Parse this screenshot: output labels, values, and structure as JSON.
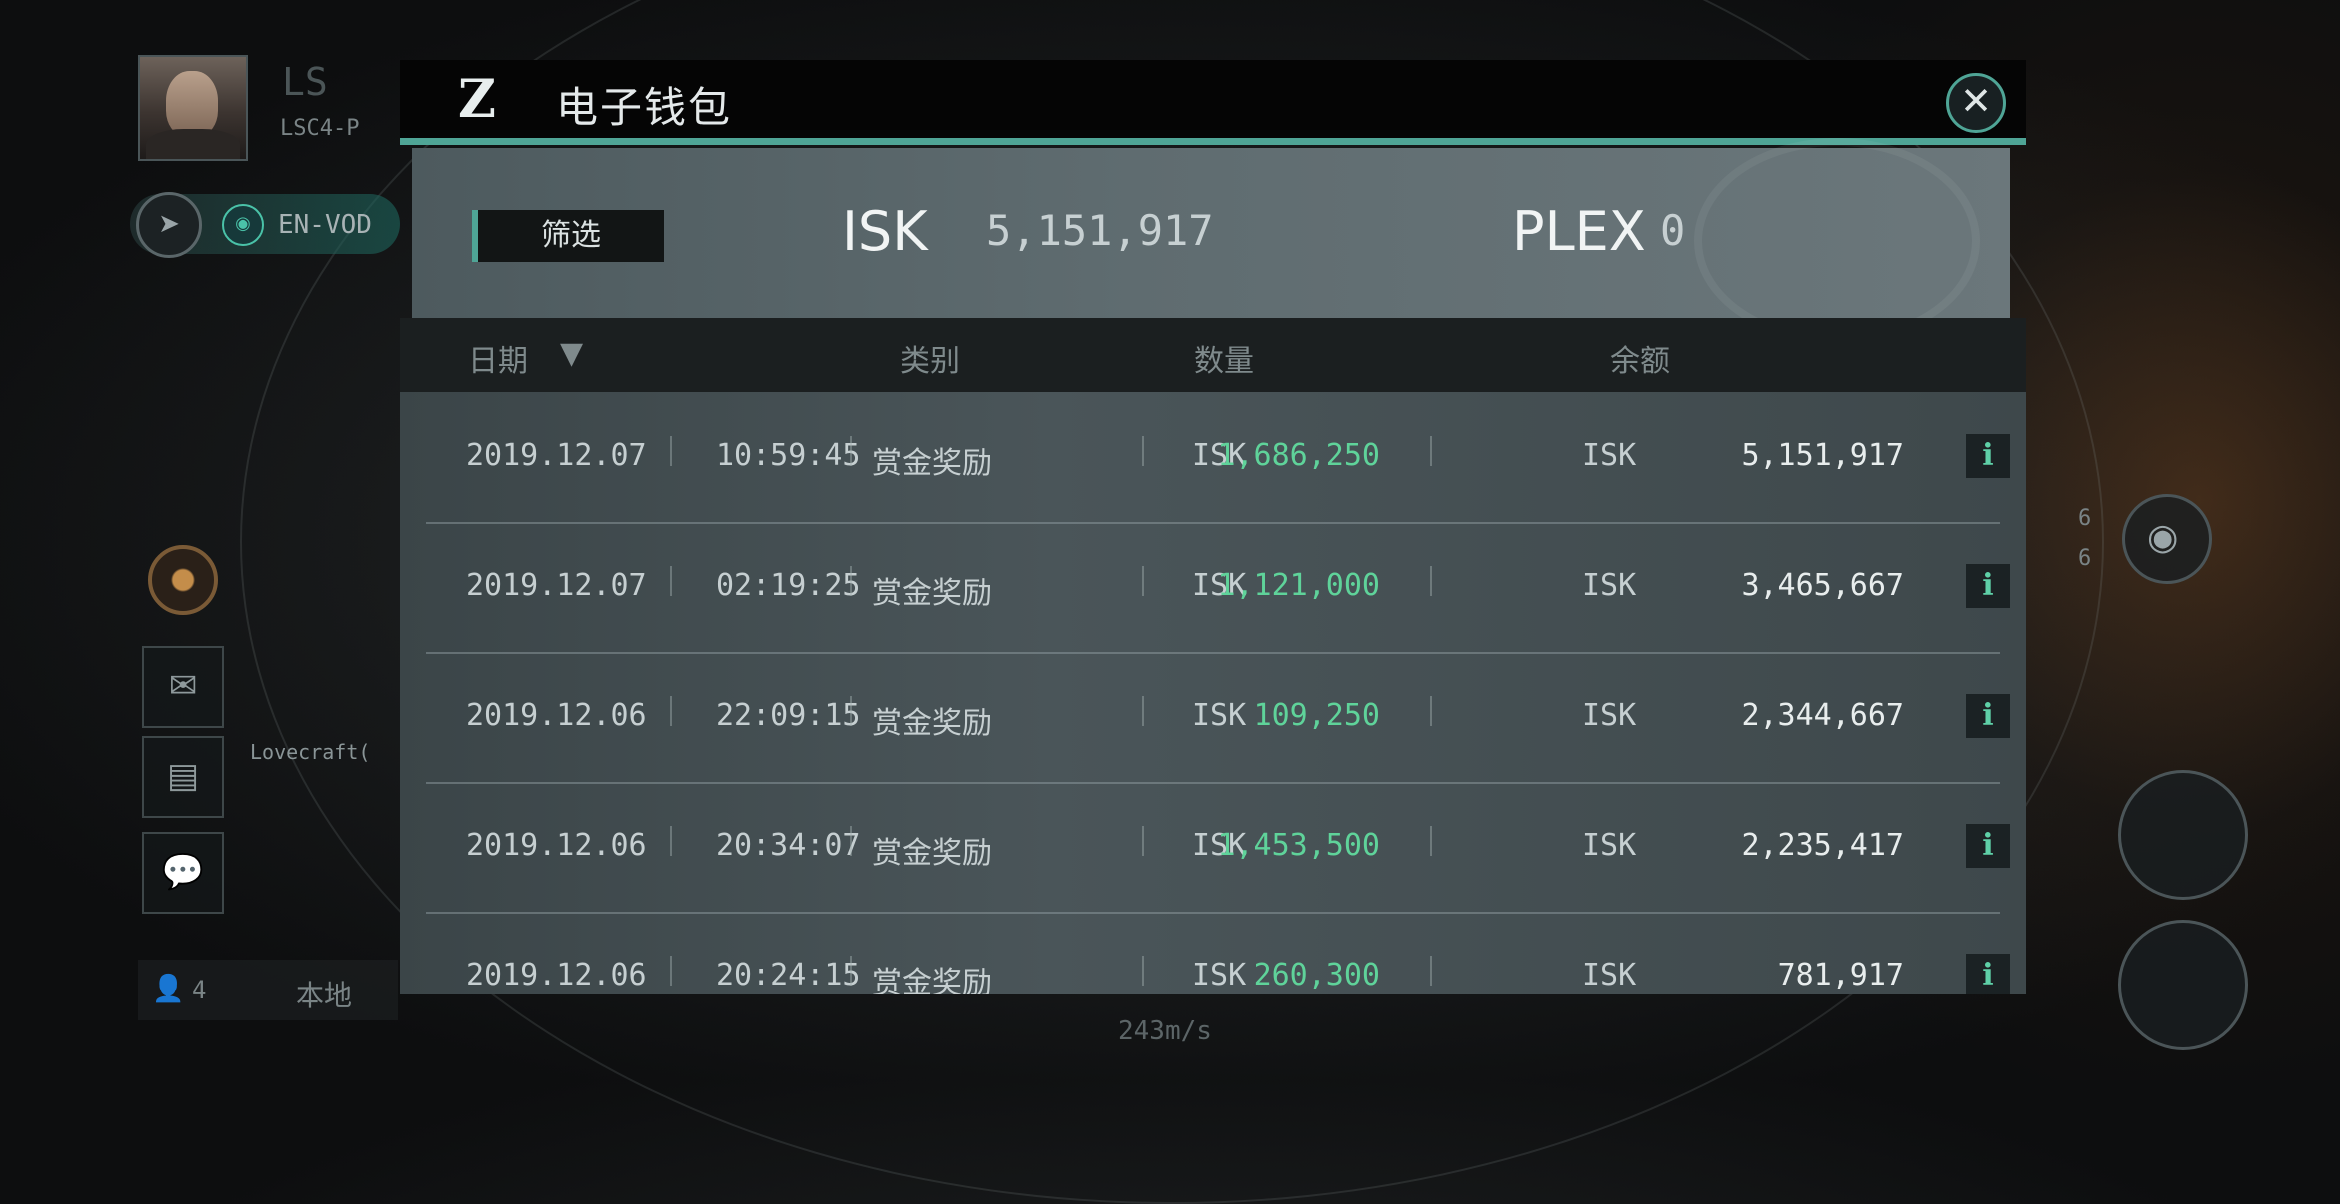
{
  "hud": {
    "system_short": "LS",
    "system_code": "LSC4-P",
    "destination": "EN-VOD",
    "pilot_name": "Lovecraft(",
    "local_count": "4",
    "local_label": "本地",
    "speed": "243m/s",
    "overview_count_1": "6",
    "overview_count_2": "6"
  },
  "wallet": {
    "title": "电子钱包",
    "close_icon": "close-icon",
    "filter_label": "筛选",
    "isk_label": "ISK",
    "isk_value": "5,151,917",
    "plex_label": "PLEX",
    "plex_value": "0",
    "columns": {
      "date": "日期",
      "category": "类别",
      "quantity": "数量",
      "balance": "余额"
    },
    "transactions": [
      {
        "date": "2019.12.07",
        "time": "10:59:45",
        "category": "赏金奖励",
        "amount_currency": "ISK",
        "amount": "1,686,250",
        "balance_currency": "ISK",
        "balance": "5,151,917"
      },
      {
        "date": "2019.12.07",
        "time": "02:19:25",
        "category": "赏金奖励",
        "amount_currency": "ISK",
        "amount": "1,121,000",
        "balance_currency": "ISK",
        "balance": "3,465,667"
      },
      {
        "date": "2019.12.06",
        "time": "22:09:15",
        "category": "赏金奖励",
        "amount_currency": "ISK",
        "amount": "109,250",
        "balance_currency": "ISK",
        "balance": "2,344,667"
      },
      {
        "date": "2019.12.06",
        "time": "20:34:07",
        "category": "赏金奖励",
        "amount_currency": "ISK",
        "amount": "1,453,500",
        "balance_currency": "ISK",
        "balance": "2,235,417"
      },
      {
        "date": "2019.12.06",
        "time": "20:24:15",
        "category": "赏金奖励",
        "amount_currency": "ISK",
        "amount": "260,300",
        "balance_currency": "ISK",
        "balance": "781,917"
      }
    ]
  },
  "colors": {
    "accent": "#4fa596",
    "positive_amount": "#5fd39a"
  }
}
